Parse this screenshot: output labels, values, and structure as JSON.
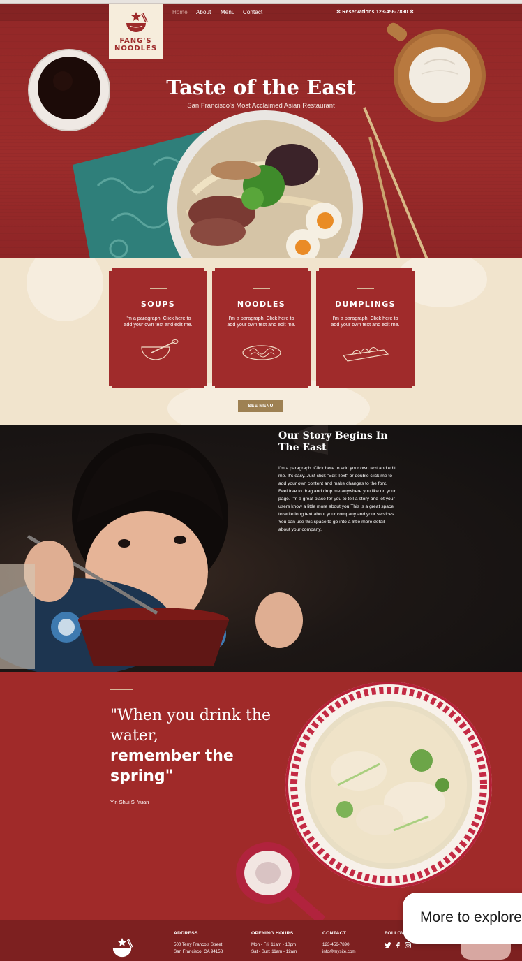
{
  "nav": {
    "links": [
      "Home",
      "About",
      "Menu",
      "Contact"
    ],
    "reservations": "✻ Reservations 123-456-7890 ✻"
  },
  "brand": {
    "line1": "FANG'S",
    "line2": "NOODLES"
  },
  "hero": {
    "title": "Taste of the East",
    "subtitle": "San Francisco's Most Acclaimed Asian Restaurant"
  },
  "menu": {
    "cards": [
      {
        "title": "SOUPS",
        "desc": "I'm a paragraph. Click here to add your own text and edit me."
      },
      {
        "title": "NOODLES",
        "desc": "I'm a paragraph. Click here to add your own text and edit me."
      },
      {
        "title": "DUMPLINGS",
        "desc": "I'm a paragraph. Click here to add your own text and edit me."
      }
    ],
    "button": "SEE MENU"
  },
  "story": {
    "title": "Our Story Begins In The East",
    "text": "I'm a paragraph. Click here to add your own text and edit me. It's easy. Just click \"Edit Text\" or double click me to add your own content and make changes to the font. Feel free to drag and drop me anywhere you like on your page. I'm a great place for you to tell a story and let your users know a little more about you.This is a great space to write long text about your company and your services. You can use this space to go into a little more detail about your company."
  },
  "quote": {
    "line1": "\"When you drink the water,",
    "line2": "remember the spring\"",
    "author": "Yin Shui Si Yuan"
  },
  "footer": {
    "address": {
      "heading": "ADDRESS",
      "line1": "500 Terry Francois Street",
      "line2": "San Francisco, CA 94158"
    },
    "hours": {
      "heading": "OPENING HOURS",
      "line1": "Mon - Fri: 11am - 10pm",
      "line2": "Sat - Sun: 11am - 12am"
    },
    "contact": {
      "heading": "CONTACT",
      "line1": "123-456-7890",
      "line2": "info@mysite.com"
    },
    "follow": {
      "heading": "FOLLOW"
    }
  },
  "overlay": {
    "label": "More to explore"
  },
  "colors": {
    "brand_red": "#a02b2b",
    "cream": "#f1e4cd",
    "gold": "#9e8153"
  }
}
